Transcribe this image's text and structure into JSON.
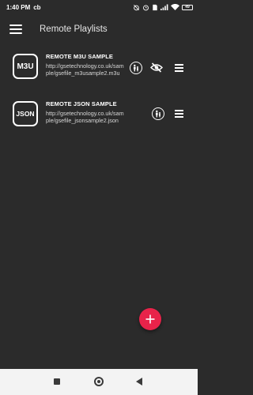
{
  "status_bar": {
    "time": "1:40 PM",
    "carrier_badge": "cb",
    "battery_level": "49",
    "icons": [
      "alarm-off-icon",
      "alarm-icon",
      "sim-icon",
      "signal-icon",
      "wifi-icon",
      "battery-icon"
    ]
  },
  "app_bar": {
    "title": "Remote Playlists",
    "menu_icon": "hamburger-menu-icon"
  },
  "playlists": [
    {
      "badge": "M3U",
      "title": "REMOTE M3U SAMPLE",
      "url": "http://gsetechnology.co.uk/sample/gsefile_m3usample2.m3u",
      "actions": [
        "parental-icon",
        "eye-off-icon",
        "drag-handle-icon"
      ]
    },
    {
      "badge": "JSON",
      "title": "REMOTE JSON SAMPLE",
      "url": "http://gsetechnology.co.uk/sample/gsefile_jsonsample2.json",
      "actions": [
        "parental-icon",
        "drag-handle-icon"
      ]
    }
  ],
  "fab": {
    "icon": "plus-icon",
    "color": "#e8234a"
  },
  "nav_bar": {
    "icons": [
      "recents-icon",
      "home-icon",
      "back-icon"
    ]
  },
  "colors": {
    "background": "#2b2b2b",
    "accent": "#e8234a",
    "nav_bar": "#f3f3f3"
  }
}
